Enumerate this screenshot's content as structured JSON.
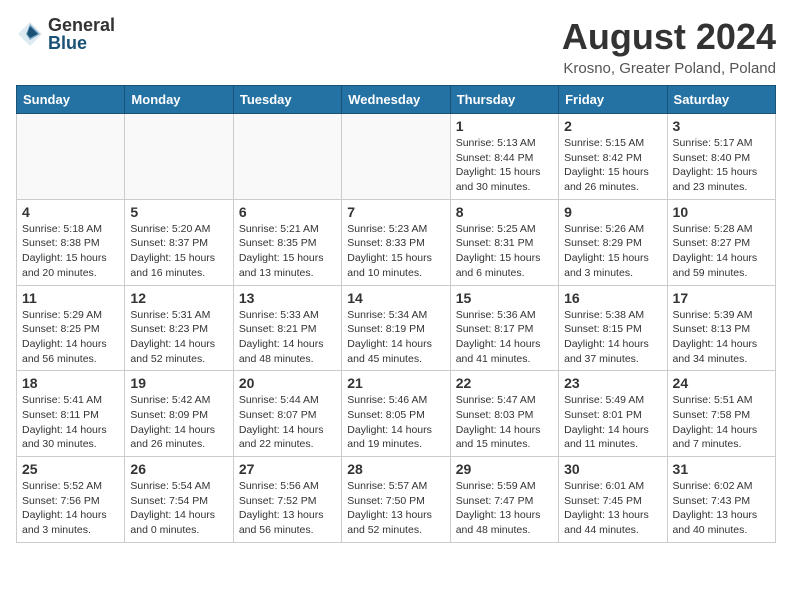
{
  "header": {
    "logo_general": "General",
    "logo_blue": "Blue",
    "month_year": "August 2024",
    "location": "Krosno, Greater Poland, Poland"
  },
  "weekdays": [
    "Sunday",
    "Monday",
    "Tuesday",
    "Wednesday",
    "Thursday",
    "Friday",
    "Saturday"
  ],
  "weeks": [
    [
      {
        "day": "",
        "info": ""
      },
      {
        "day": "",
        "info": ""
      },
      {
        "day": "",
        "info": ""
      },
      {
        "day": "",
        "info": ""
      },
      {
        "day": "1",
        "info": "Sunrise: 5:13 AM\nSunset: 8:44 PM\nDaylight: 15 hours\nand 30 minutes."
      },
      {
        "day": "2",
        "info": "Sunrise: 5:15 AM\nSunset: 8:42 PM\nDaylight: 15 hours\nand 26 minutes."
      },
      {
        "day": "3",
        "info": "Sunrise: 5:17 AM\nSunset: 8:40 PM\nDaylight: 15 hours\nand 23 minutes."
      }
    ],
    [
      {
        "day": "4",
        "info": "Sunrise: 5:18 AM\nSunset: 8:38 PM\nDaylight: 15 hours\nand 20 minutes."
      },
      {
        "day": "5",
        "info": "Sunrise: 5:20 AM\nSunset: 8:37 PM\nDaylight: 15 hours\nand 16 minutes."
      },
      {
        "day": "6",
        "info": "Sunrise: 5:21 AM\nSunset: 8:35 PM\nDaylight: 15 hours\nand 13 minutes."
      },
      {
        "day": "7",
        "info": "Sunrise: 5:23 AM\nSunset: 8:33 PM\nDaylight: 15 hours\nand 10 minutes."
      },
      {
        "day": "8",
        "info": "Sunrise: 5:25 AM\nSunset: 8:31 PM\nDaylight: 15 hours\nand 6 minutes."
      },
      {
        "day": "9",
        "info": "Sunrise: 5:26 AM\nSunset: 8:29 PM\nDaylight: 15 hours\nand 3 minutes."
      },
      {
        "day": "10",
        "info": "Sunrise: 5:28 AM\nSunset: 8:27 PM\nDaylight: 14 hours\nand 59 minutes."
      }
    ],
    [
      {
        "day": "11",
        "info": "Sunrise: 5:29 AM\nSunset: 8:25 PM\nDaylight: 14 hours\nand 56 minutes."
      },
      {
        "day": "12",
        "info": "Sunrise: 5:31 AM\nSunset: 8:23 PM\nDaylight: 14 hours\nand 52 minutes."
      },
      {
        "day": "13",
        "info": "Sunrise: 5:33 AM\nSunset: 8:21 PM\nDaylight: 14 hours\nand 48 minutes."
      },
      {
        "day": "14",
        "info": "Sunrise: 5:34 AM\nSunset: 8:19 PM\nDaylight: 14 hours\nand 45 minutes."
      },
      {
        "day": "15",
        "info": "Sunrise: 5:36 AM\nSunset: 8:17 PM\nDaylight: 14 hours\nand 41 minutes."
      },
      {
        "day": "16",
        "info": "Sunrise: 5:38 AM\nSunset: 8:15 PM\nDaylight: 14 hours\nand 37 minutes."
      },
      {
        "day": "17",
        "info": "Sunrise: 5:39 AM\nSunset: 8:13 PM\nDaylight: 14 hours\nand 34 minutes."
      }
    ],
    [
      {
        "day": "18",
        "info": "Sunrise: 5:41 AM\nSunset: 8:11 PM\nDaylight: 14 hours\nand 30 minutes."
      },
      {
        "day": "19",
        "info": "Sunrise: 5:42 AM\nSunset: 8:09 PM\nDaylight: 14 hours\nand 26 minutes."
      },
      {
        "day": "20",
        "info": "Sunrise: 5:44 AM\nSunset: 8:07 PM\nDaylight: 14 hours\nand 22 minutes."
      },
      {
        "day": "21",
        "info": "Sunrise: 5:46 AM\nSunset: 8:05 PM\nDaylight: 14 hours\nand 19 minutes."
      },
      {
        "day": "22",
        "info": "Sunrise: 5:47 AM\nSunset: 8:03 PM\nDaylight: 14 hours\nand 15 minutes."
      },
      {
        "day": "23",
        "info": "Sunrise: 5:49 AM\nSunset: 8:01 PM\nDaylight: 14 hours\nand 11 minutes."
      },
      {
        "day": "24",
        "info": "Sunrise: 5:51 AM\nSunset: 7:58 PM\nDaylight: 14 hours\nand 7 minutes."
      }
    ],
    [
      {
        "day": "25",
        "info": "Sunrise: 5:52 AM\nSunset: 7:56 PM\nDaylight: 14 hours\nand 3 minutes."
      },
      {
        "day": "26",
        "info": "Sunrise: 5:54 AM\nSunset: 7:54 PM\nDaylight: 14 hours\nand 0 minutes."
      },
      {
        "day": "27",
        "info": "Sunrise: 5:56 AM\nSunset: 7:52 PM\nDaylight: 13 hours\nand 56 minutes."
      },
      {
        "day": "28",
        "info": "Sunrise: 5:57 AM\nSunset: 7:50 PM\nDaylight: 13 hours\nand 52 minutes."
      },
      {
        "day": "29",
        "info": "Sunrise: 5:59 AM\nSunset: 7:47 PM\nDaylight: 13 hours\nand 48 minutes."
      },
      {
        "day": "30",
        "info": "Sunrise: 6:01 AM\nSunset: 7:45 PM\nDaylight: 13 hours\nand 44 minutes."
      },
      {
        "day": "31",
        "info": "Sunrise: 6:02 AM\nSunset: 7:43 PM\nDaylight: 13 hours\nand 40 minutes."
      }
    ]
  ]
}
